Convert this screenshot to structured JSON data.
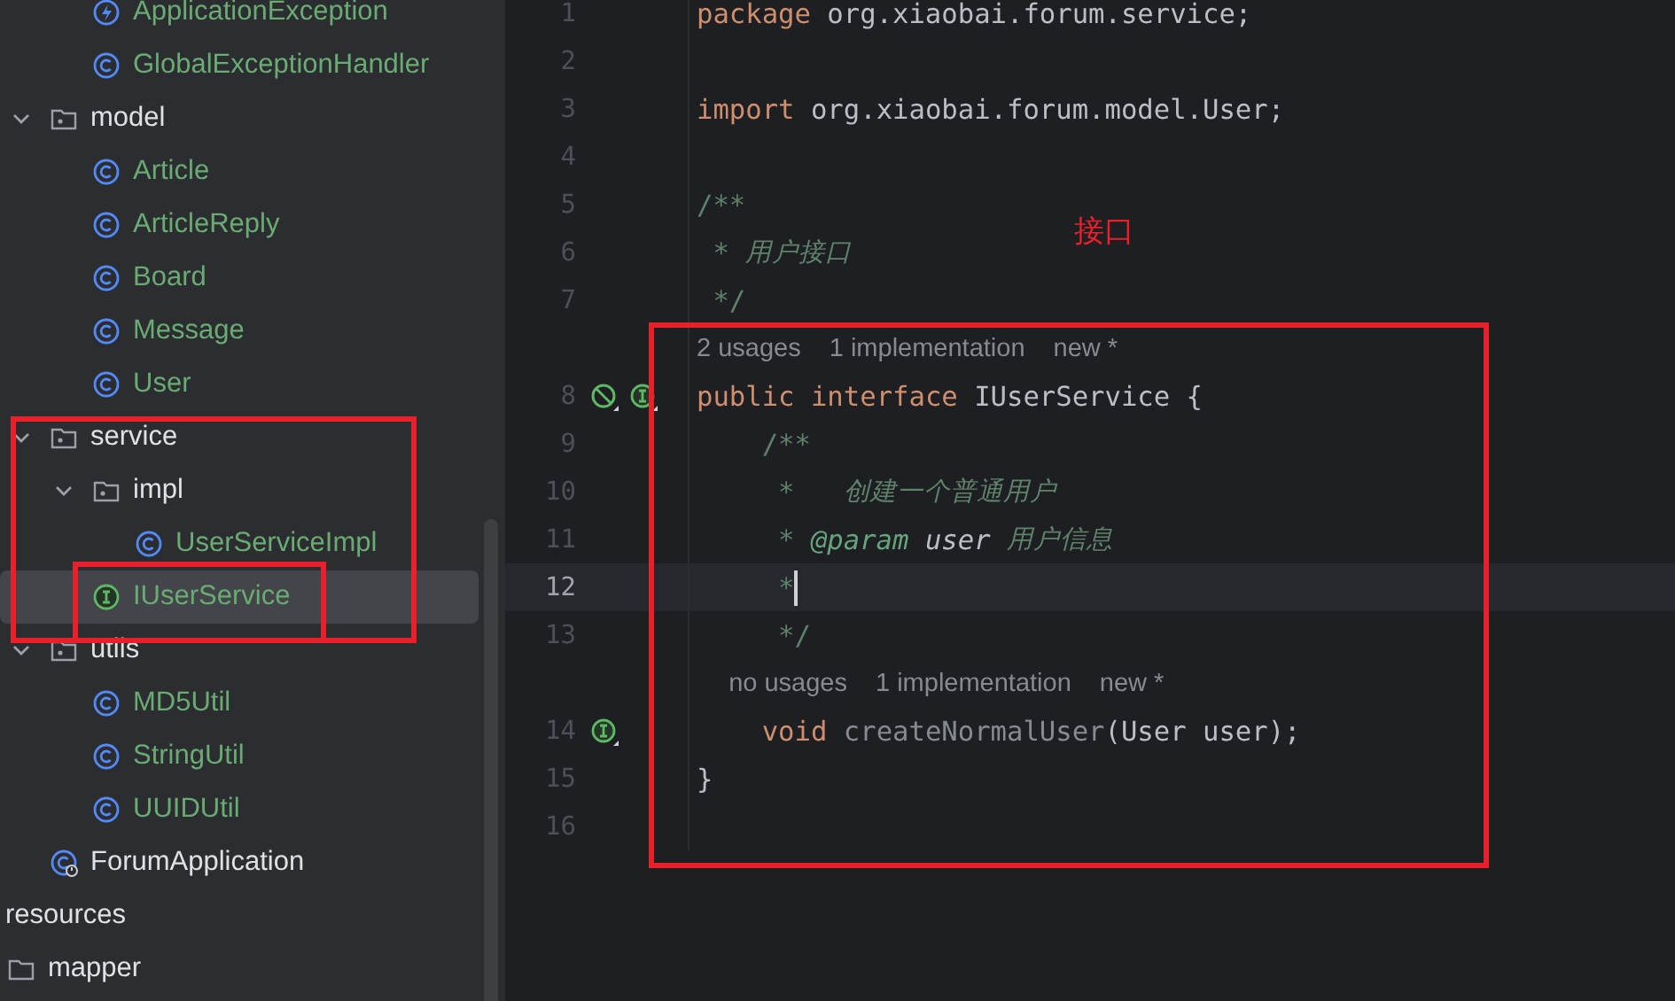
{
  "project_tree": {
    "items": [
      {
        "children": [
          {
            "children": [
              {
                "children": [
                  {
                    "label": "ApplicationException",
                    "kind": "exception-class",
                    "color": "#6aab73",
                    "selected": false
                  },
                  {
                    "label": "GlobalExceptionHandler",
                    "kind": "class",
                    "color": "#6aab73",
                    "selected": false
                  }
                ]
              },
              {
                "label": "model",
                "kind": "package",
                "color": "#dfe1e5",
                "expanded": true,
                "selected": false,
                "children": [
                  {
                    "label": "Article",
                    "kind": "class",
                    "color": "#6aab73",
                    "selected": false
                  },
                  {
                    "label": "ArticleReply",
                    "kind": "class",
                    "color": "#6aab73",
                    "selected": false
                  },
                  {
                    "label": "Board",
                    "kind": "class",
                    "color": "#6aab73",
                    "selected": false
                  },
                  {
                    "label": "Message",
                    "kind": "class",
                    "color": "#6aab73",
                    "selected": false
                  },
                  {
                    "label": "User",
                    "kind": "class",
                    "color": "#6aab73",
                    "selected": false
                  }
                ]
              },
              {
                "label": "service",
                "kind": "package",
                "color": "#dfe1e5",
                "expanded": true,
                "selected": false,
                "children": [
                  {
                    "label": "impl",
                    "kind": "package",
                    "color": "#dfe1e5",
                    "expanded": true,
                    "selected": false,
                    "children": [
                      {
                        "label": "UserServiceImpl",
                        "kind": "class",
                        "color": "#6aab73",
                        "selected": false
                      }
                    ]
                  },
                  {
                    "label": "IUserService",
                    "kind": "interface",
                    "color": "#6aab73",
                    "selected": true
                  }
                ]
              },
              {
                "label": "utils",
                "kind": "package",
                "color": "#dfe1e5",
                "expanded": true,
                "selected": false,
                "children": [
                  {
                    "label": "MD5Util",
                    "kind": "class",
                    "color": "#6aab73",
                    "selected": false
                  },
                  {
                    "label": "StringUtil",
                    "kind": "class",
                    "color": "#6aab73",
                    "selected": false
                  },
                  {
                    "label": "UUIDUtil",
                    "kind": "class",
                    "color": "#6aab73",
                    "selected": false
                  }
                ]
              },
              {
                "label": "ForumApplication",
                "kind": "main-class",
                "color": "#dfe1e5",
                "selected": false
              }
            ]
          }
        ]
      },
      {
        "label": "resources",
        "color": "#dfe1e5",
        "selected": false,
        "children": [
          {
            "label": "mapper",
            "kind": "folder",
            "color": "#dfe1e5",
            "selected": false
          }
        ]
      }
    ]
  },
  "editor": {
    "lines": [
      {
        "kind": "code",
        "number": "1",
        "tokens": [
          {
            "kind": "keyword",
            "text": "package"
          },
          {
            "kind": "plain",
            "text": " org.xiaobai.forum.service;"
          }
        ]
      },
      {
        "kind": "code",
        "number": "2"
      },
      {
        "kind": "code",
        "number": "3",
        "tokens": [
          {
            "kind": "keyword",
            "text": "import"
          },
          {
            "kind": "plain",
            "text": " org.xiaobai.forum.model.User;"
          }
        ]
      },
      {
        "kind": "code",
        "number": "4"
      },
      {
        "kind": "code",
        "number": "5",
        "tokens": [
          {
            "kind": "doc",
            "text": "/**"
          }
        ]
      },
      {
        "kind": "code",
        "number": "6",
        "tokens": [
          {
            "kind": "doc",
            "text": " * "
          },
          {
            "kind": "doc-text",
            "text": "用户接口"
          }
        ]
      },
      {
        "kind": "code",
        "number": "7",
        "tokens": [
          {
            "kind": "doc",
            "text": " */"
          }
        ]
      },
      {
        "kind": "hint",
        "hints": [
          "2 usages",
          "1 implementation",
          "new *"
        ]
      },
      {
        "kind": "code",
        "number": "8",
        "gutter_icons": [
          {
            "kind": "no-entry"
          },
          {
            "kind": "implemented"
          }
        ],
        "tokens": [
          {
            "kind": "keyword",
            "text": "public"
          },
          {
            "kind": "keyword",
            "text": " interface"
          },
          {
            "kind": "plain",
            "text": " IUserService {"
          }
        ]
      },
      {
        "kind": "code",
        "number": "9",
        "tokens": [
          {
            "kind": "doc",
            "text": "    /**"
          }
        ]
      },
      {
        "kind": "code",
        "number": "10",
        "tokens": [
          {
            "kind": "doc",
            "text": "     *   "
          },
          {
            "kind": "doc-text",
            "text": "创建一个普通用户"
          }
        ]
      },
      {
        "kind": "code",
        "number": "11",
        "tokens": [
          {
            "kind": "doc",
            "text": "     * "
          },
          {
            "kind": "doc-tag",
            "text": "@param"
          },
          {
            "kind": "doc-param",
            "text": " user "
          },
          {
            "kind": "doc-text",
            "text": "用户信息"
          }
        ]
      },
      {
        "kind": "code",
        "number": "12",
        "current": true,
        "tokens": [
          {
            "kind": "doc",
            "text": "     *"
          }
        ]
      },
      {
        "kind": "code",
        "number": "13",
        "tokens": [
          {
            "kind": "doc",
            "text": "     */"
          }
        ]
      },
      {
        "kind": "hint",
        "hints": [
          "no usages",
          "1 implementation",
          "new *"
        ]
      },
      {
        "kind": "code",
        "number": "14",
        "gutter_icons": [
          {
            "kind": "implemented"
          }
        ],
        "tokens": [
          {
            "kind": "keyword",
            "text": "    void"
          },
          {
            "kind": "unused",
            "text": " createNormalUser"
          },
          {
            "kind": "plain",
            "text": "(User user);"
          }
        ]
      },
      {
        "kind": "code",
        "number": "15",
        "tokens": [
          {
            "kind": "plain",
            "text": "}"
          }
        ]
      },
      {
        "kind": "code",
        "number": "16"
      }
    ]
  },
  "annotation_label": "接口"
}
